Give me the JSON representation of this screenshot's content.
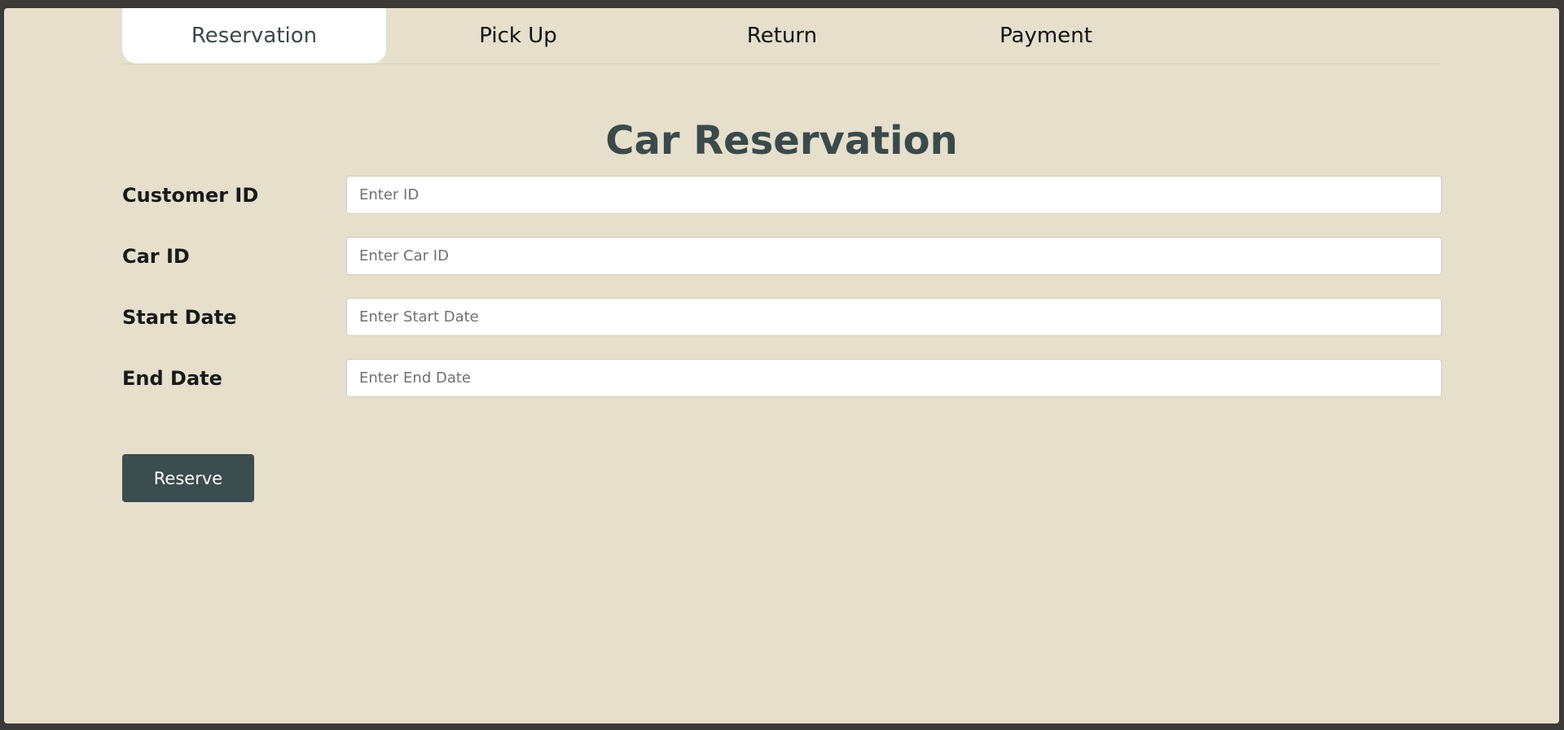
{
  "tabs": [
    {
      "label": "Reservation",
      "active": true
    },
    {
      "label": "Pick Up",
      "active": false
    },
    {
      "label": "Return",
      "active": false
    },
    {
      "label": "Payment",
      "active": false
    }
  ],
  "page": {
    "title": "Car Reservation"
  },
  "form": {
    "fields": [
      {
        "label": "Customer ID",
        "value": "",
        "placeholder": "Enter ID"
      },
      {
        "label": "Car ID",
        "value": "",
        "placeholder": "Enter Car ID"
      },
      {
        "label": "Start Date",
        "value": "",
        "placeholder": "Enter Start Date"
      },
      {
        "label": "End Date",
        "value": "",
        "placeholder": "Enter End Date"
      }
    ],
    "submit_label": "Reserve"
  },
  "colors": {
    "background": "#e5dfcc",
    "accent": "#3b4d4e",
    "title": "#3a4a4a",
    "active_tab": "#ffffff"
  }
}
